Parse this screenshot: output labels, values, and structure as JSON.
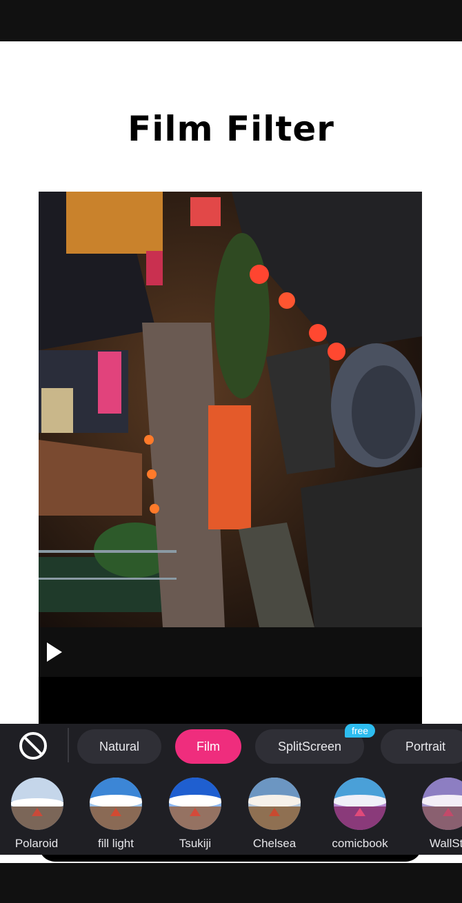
{
  "title": "Film Filter",
  "player": {
    "play_icon": "play-icon"
  },
  "tabs": {
    "none_icon": "no-filter-icon",
    "items": [
      {
        "label": "Natural",
        "active": false
      },
      {
        "label": "Film",
        "active": true
      },
      {
        "label": "SplitScreen",
        "active": false
      },
      {
        "label": "Portrait",
        "active": false
      }
    ],
    "badge": "free"
  },
  "filters": [
    {
      "label": "Polaroid",
      "tint": "#d6dbe0"
    },
    {
      "label": "fill light",
      "tint": "#ffffff"
    },
    {
      "label": "Tsukiji",
      "tint": "#c9d9ff"
    },
    {
      "label": "Chelsea",
      "tint": "#ffe6c8"
    },
    {
      "label": "comicbook",
      "tint": "#b27ad0"
    },
    {
      "label": "WallStr",
      "tint": "#8e7fb8"
    }
  ],
  "colors": {
    "accent": "#ef2d7d",
    "badge": "#2dbdf0",
    "panel": "#1f1f24"
  }
}
